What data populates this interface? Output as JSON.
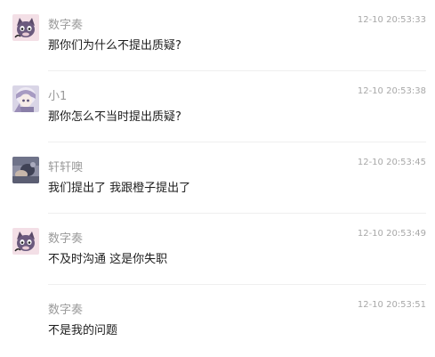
{
  "messages": [
    {
      "name": "数字奏",
      "time": "12-10 20:53:33",
      "text": "那你们为什么不提出质疑?",
      "avatar": "cat-mascot-icon"
    },
    {
      "name": "小1",
      "time": "12-10 20:53:38",
      "text": "那你怎么不当时提出质疑?",
      "avatar": "anime-character-icon"
    },
    {
      "name": "轩轩噢",
      "time": "12-10 20:53:45",
      "text": "我们提出了 我跟橙子提出了",
      "avatar": "photo-avatar-icon"
    },
    {
      "name": "数字奏",
      "time": "12-10 20:53:49",
      "text": "不及时沟通 这是你失职",
      "avatar": "cat-mascot-icon"
    },
    {
      "name": "数字奏",
      "time": "12-10 20:53:51",
      "text": "不是我的问题",
      "avatar": ""
    }
  ]
}
